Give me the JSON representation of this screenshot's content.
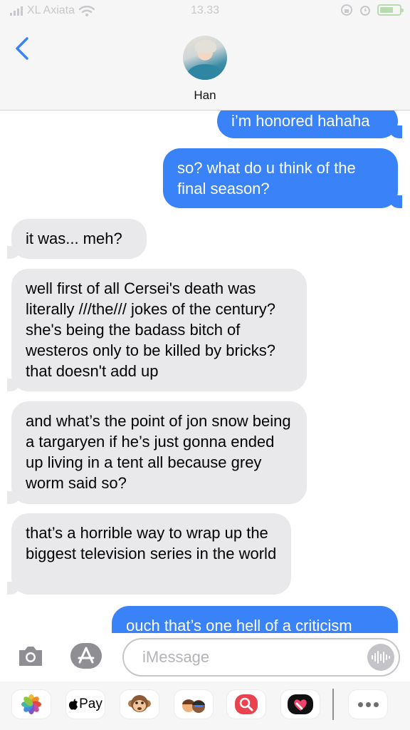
{
  "status_bar": {
    "carrier": "XL Axiata",
    "time": "13.33"
  },
  "contact": {
    "name": "Han"
  },
  "messages": [
    {
      "side": "sent",
      "text": "i’m honored hahaha"
    },
    {
      "side": "sent",
      "text": "so? what do u think of the final season?"
    },
    {
      "side": "received",
      "text": "it was... meh?"
    },
    {
      "side": "received",
      "text": "well first of all Cersei's death was literally ///the/// jokes of the century? she's being the badass bitch of westeros only to be killed by bricks? that doesn't add up"
    },
    {
      "side": "received",
      "text": "and what’s the point of jon snow being a targaryen if he’s just gonna ended up living in a tent all because grey worm said so?"
    },
    {
      "side": "received",
      "text": "that’s a horrible way to wrap up the biggest television series in the world"
    },
    {
      "side": "sent",
      "text": "ouch that’s one hell of a criticism"
    }
  ],
  "input": {
    "placeholder": "iMessage"
  },
  "app_drawer": {
    "apps": [
      "photos-icon",
      "apple-pay-icon",
      "monkey-memoji-icon",
      "memoji-stickers-icon",
      "search-images-icon",
      "digital-touch-icon",
      "more-icon"
    ],
    "pay_label": "Pay"
  },
  "colors": {
    "sent_bubble": "#3a82f7",
    "received_bubble": "#e9e9eb",
    "accent": "#3a82f7"
  }
}
